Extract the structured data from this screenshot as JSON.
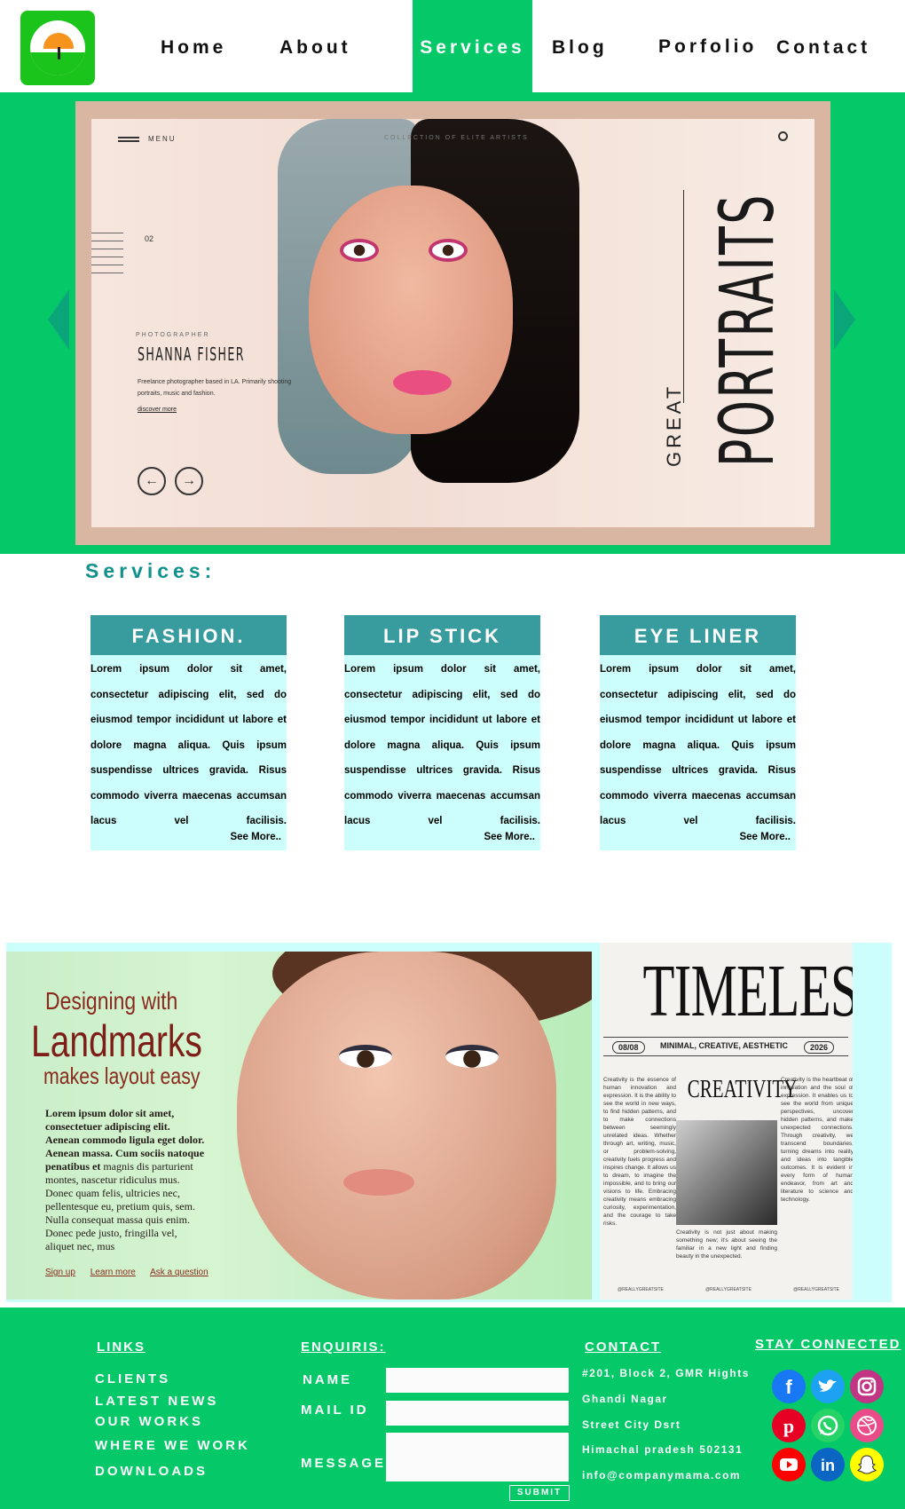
{
  "nav": {
    "items": [
      {
        "label": "Home"
      },
      {
        "label": "About"
      },
      {
        "label": "Services"
      },
      {
        "label": "Blog"
      },
      {
        "label": "Porfolio"
      },
      {
        "label": "Contact"
      }
    ],
    "active": "Services"
  },
  "hero": {
    "menu_label": "MENU",
    "top_text": "COLLECTION OF ELITE ARTISTS",
    "slide_number": "02",
    "photographer_label": "PHOTOGRAPHER",
    "name": "SHANNA FISHER",
    "description": "Freelance photographer based in LA. Primarily shooting portraits, music and fashion.",
    "discover": "discover more",
    "headline_small": "GREAT",
    "headline_big": "PORTRAITS"
  },
  "services": {
    "title": "Services:",
    "cards": [
      {
        "title": "FASHION.",
        "body": "Lorem ipsum dolor sit amet, consectetur adipiscing elit, sed do eiusmod tempor incididunt ut labore et dolore magna aliqua. Quis ipsum suspendisse ultrices gravida. Risus commodo viverra maecenas accumsan lacus vel facilisis.",
        "more": "See More.."
      },
      {
        "title": "LIP STICK",
        "body": "Lorem ipsum dolor sit amet, consectetur adipiscing elit, sed do eiusmod tempor incididunt ut labore et dolore magna aliqua. Quis ipsum suspendisse ultrices gravida. Risus commodo viverra maecenas accumsan lacus vel facilisis.",
        "more": "See More.."
      },
      {
        "title": "EYE LINER",
        "body": "Lorem ipsum dolor sit amet, consectetur adipiscing elit, sed do eiusmod tempor incididunt ut labore et dolore magna aliqua. Quis ipsum suspendisse ultrices gravida. Risus commodo viverra maecenas accumsan lacus vel facilisis.",
        "more": "See More.."
      }
    ]
  },
  "ad": {
    "line1": "Designing with",
    "line2": "Landmarks",
    "line3": "makes layout easy",
    "lorem_bold": "Lorem ipsum dolor sit amet, consectetuer adipiscing elit. Aenean commodo ligula eget dolor. Aenean massa. Cum sociis natoque penatibus et",
    "lorem": "magnis dis parturient montes, nascetur ridiculus mus. Donec quam felis, ultricies nec, pellentesque eu, pretium quis, sem. Nulla consequat massa quis enim. Donec pede justo, fringilla vel, aliquet nec, mus",
    "links": [
      "Sign up",
      "Learn more",
      "Ask a question"
    ]
  },
  "news": {
    "title": "TIMELESS",
    "date": "08/08",
    "tagline": "MINIMAL, CREATIVE, AESTHETIC",
    "year": "2026",
    "subtitle": "CREATIVITY",
    "col_left": "Creativity is the essence of human innovation and expression. It is the ability to see the world in new ways, to find hidden patterns, and to make connections between seemingly unrelated ideas. Whether through art, writing, music, or problem-solving, creativity fuels progress and inspires change. It allows us to dream, to imagine the impossible, and to bring our visions to life. Embracing creativity means embracing curiosity, experimentation, and the courage to take risks.",
    "col_mid": "Creativity is not just about making something new; it's about seeing the familiar in a new light and finding beauty in the unexpected.",
    "col_right": "Creativity is the heartbeat of innovation and the soul of expression. It enables us to see the world from unique perspectives, uncover hidden patterns, and make unexpected connections. Through creativity, we transcend boundaries, turning dreams into reality and ideas into tangible outcomes. It is evident in every form of human endeavor, from art and literature to science and technology.",
    "handle": "@REALLYGREATSITE"
  },
  "footer": {
    "links_title": "LINKS",
    "links": [
      "CLIENTS",
      "LATEST NEWS",
      "OUR WORKS",
      "WHERE WE WORK",
      "DOWNLOADS"
    ],
    "enquiry_title": "ENQUIRIS:",
    "name_label": "NAME",
    "mail_label": "MAIL ID",
    "message_label": "MESSAGE",
    "submit": "SUBMIT",
    "contact_title": "CONTACT",
    "address": [
      "#201, Block 2, GMR Hights",
      "Ghandi Nagar",
      "Street City Dsrt",
      "Himachal pradesh 502131",
      "info@companymama.com"
    ],
    "social_title": "STAY CONNECTED",
    "social": [
      {
        "name": "facebook-icon",
        "color": "#1877f2"
      },
      {
        "name": "twitter-icon",
        "color": "#1da1f2"
      },
      {
        "name": "instagram-icon",
        "color": "#c13584"
      },
      {
        "name": "pinterest-icon",
        "color": "#e60023"
      },
      {
        "name": "whatsapp-icon",
        "color": "#25d366"
      },
      {
        "name": "dribbble-icon",
        "color": "#ea4c89"
      },
      {
        "name": "youtube-icon",
        "color": "#ff0000"
      },
      {
        "name": "linkedin-icon",
        "color": "#0a66c2"
      },
      {
        "name": "snapchat-icon",
        "color": "#fffc00"
      }
    ]
  },
  "colors": {
    "brand_green": "#05c869",
    "teal": "#389c9f",
    "card_bg": "#ccfffb"
  }
}
